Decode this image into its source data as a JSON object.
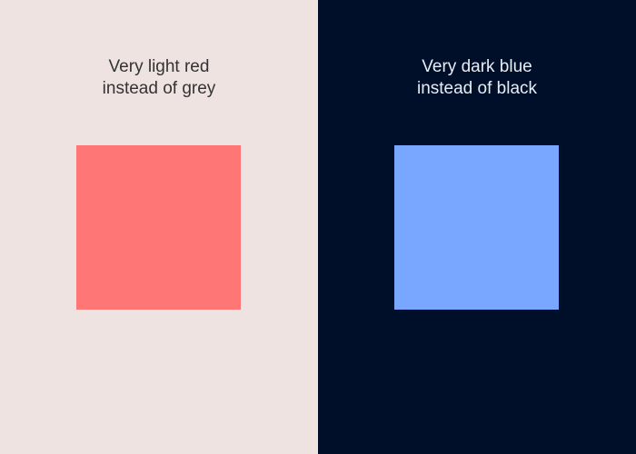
{
  "panels": [
    {
      "caption": "Very light red\ninstead of grey",
      "background_color": "#EFE3E2",
      "text_color": "#333333",
      "swatch_color": "#FF7676"
    },
    {
      "caption": "Very dark blue\ninstead of black",
      "background_color": "#000F29",
      "text_color": "#E8ECF4",
      "swatch_color": "#79A6FF"
    }
  ]
}
